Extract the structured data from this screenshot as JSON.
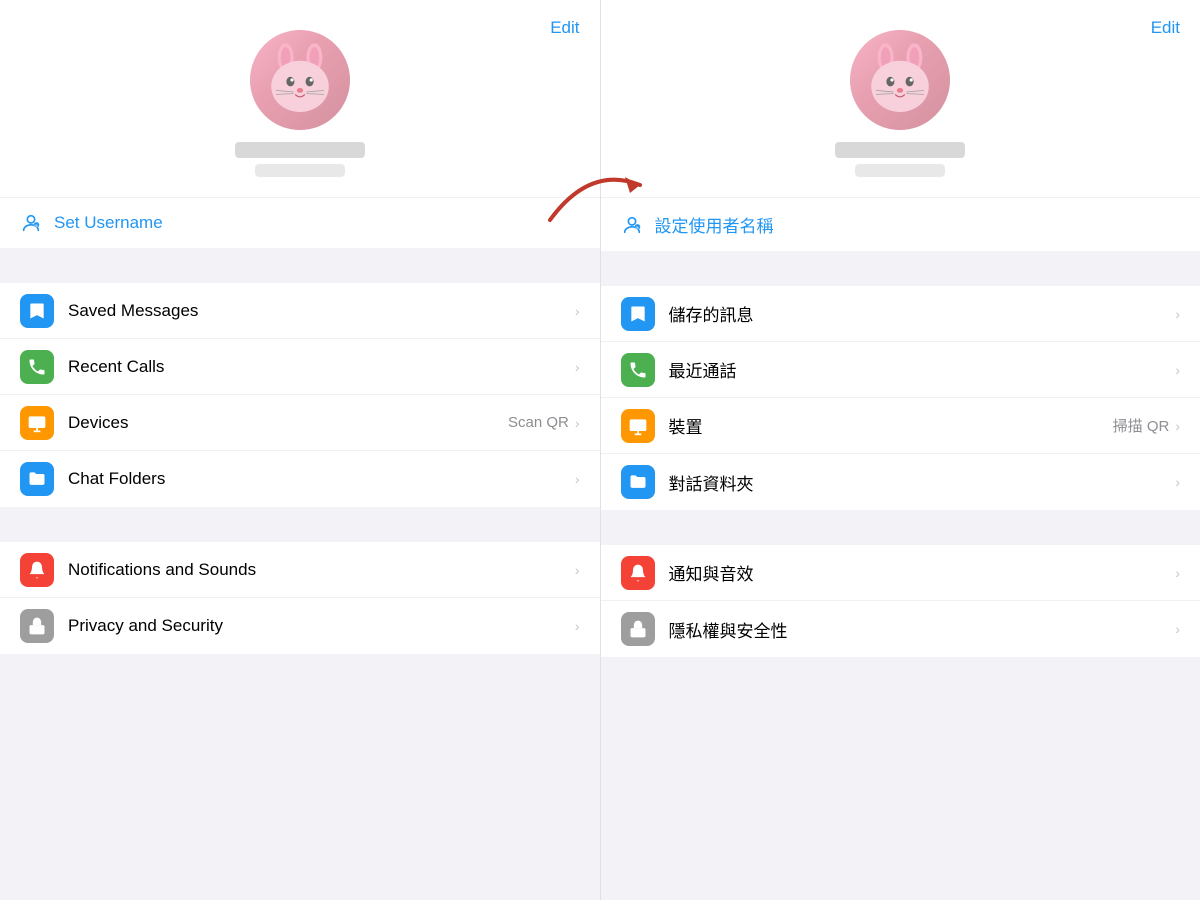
{
  "left": {
    "edit_label": "Edit",
    "username_label": "Set Username",
    "menu_items": [
      {
        "id": "saved-messages",
        "label": "Saved Messages",
        "icon_type": "bookmark",
        "icon_color": "blue",
        "extra": "",
        "chevron": "›"
      },
      {
        "id": "recent-calls",
        "label": "Recent Calls",
        "icon_type": "phone",
        "icon_color": "green",
        "extra": "",
        "chevron": "›"
      },
      {
        "id": "devices",
        "label": "Devices",
        "icon_type": "monitor",
        "icon_color": "orange",
        "extra": "Scan QR",
        "chevron": "›"
      },
      {
        "id": "chat-folders",
        "label": "Chat Folders",
        "icon_type": "folder",
        "icon_color": "teal",
        "extra": "",
        "chevron": "›"
      }
    ],
    "menu_items2": [
      {
        "id": "notifications",
        "label": "Notifications and Sounds",
        "icon_type": "bell",
        "icon_color": "red",
        "extra": "",
        "chevron": "›"
      },
      {
        "id": "privacy",
        "label": "Privacy and Security",
        "icon_type": "lock",
        "icon_color": "gray",
        "extra": "",
        "chevron": "›"
      }
    ]
  },
  "right": {
    "edit_label": "Edit",
    "username_label": "設定使用者名稱",
    "menu_items": [
      {
        "id": "saved-messages-tw",
        "label": "儲存的訊息",
        "icon_type": "bookmark",
        "icon_color": "blue",
        "extra": "",
        "chevron": "›"
      },
      {
        "id": "recent-calls-tw",
        "label": "最近通話",
        "icon_type": "phone",
        "icon_color": "green",
        "extra": "",
        "chevron": "›"
      },
      {
        "id": "devices-tw",
        "label": "裝置",
        "icon_type": "monitor",
        "icon_color": "orange",
        "extra": "掃描 QR",
        "chevron": "›"
      },
      {
        "id": "chat-folders-tw",
        "label": "對話資料夾",
        "icon_type": "folder",
        "icon_color": "teal",
        "extra": "",
        "chevron": "›"
      }
    ],
    "menu_items2": [
      {
        "id": "notifications-tw",
        "label": "通知與音效",
        "icon_type": "bell",
        "icon_color": "red",
        "extra": "",
        "chevron": "›"
      },
      {
        "id": "privacy-tw",
        "label": "隱私權與安全性",
        "icon_type": "lock",
        "icon_color": "gray",
        "extra": "",
        "chevron": "›"
      }
    ]
  },
  "arrow": "→"
}
